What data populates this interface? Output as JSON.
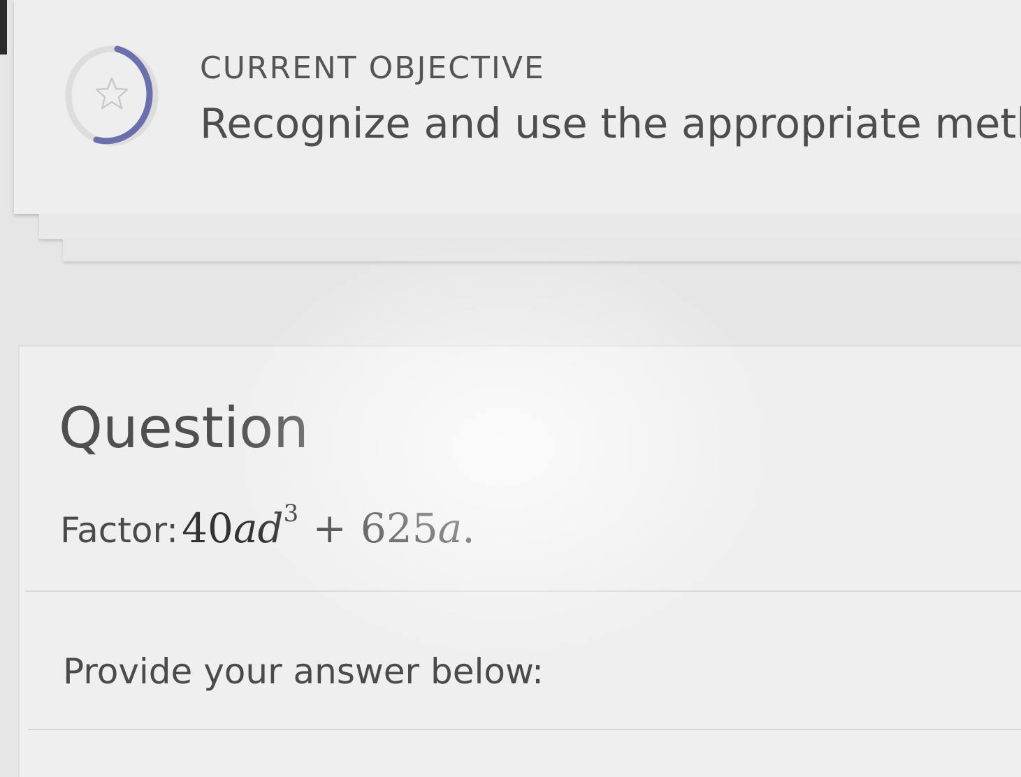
{
  "objective": {
    "label": "CURRENT OBJECTIVE",
    "text": "Recognize and use the appropriate method t",
    "icon": "star-icon",
    "ring_color": "#6b70ad"
  },
  "question": {
    "title": "Question",
    "prompt_label": "Factor:",
    "expression": {
      "coefficient_1": "40",
      "var_1": "a",
      "var_2": "d",
      "exponent": "3",
      "operator": "+",
      "coefficient_2": "625",
      "var_3": "a",
      "terminator": "."
    },
    "answer_label": "Provide your answer below:"
  }
}
